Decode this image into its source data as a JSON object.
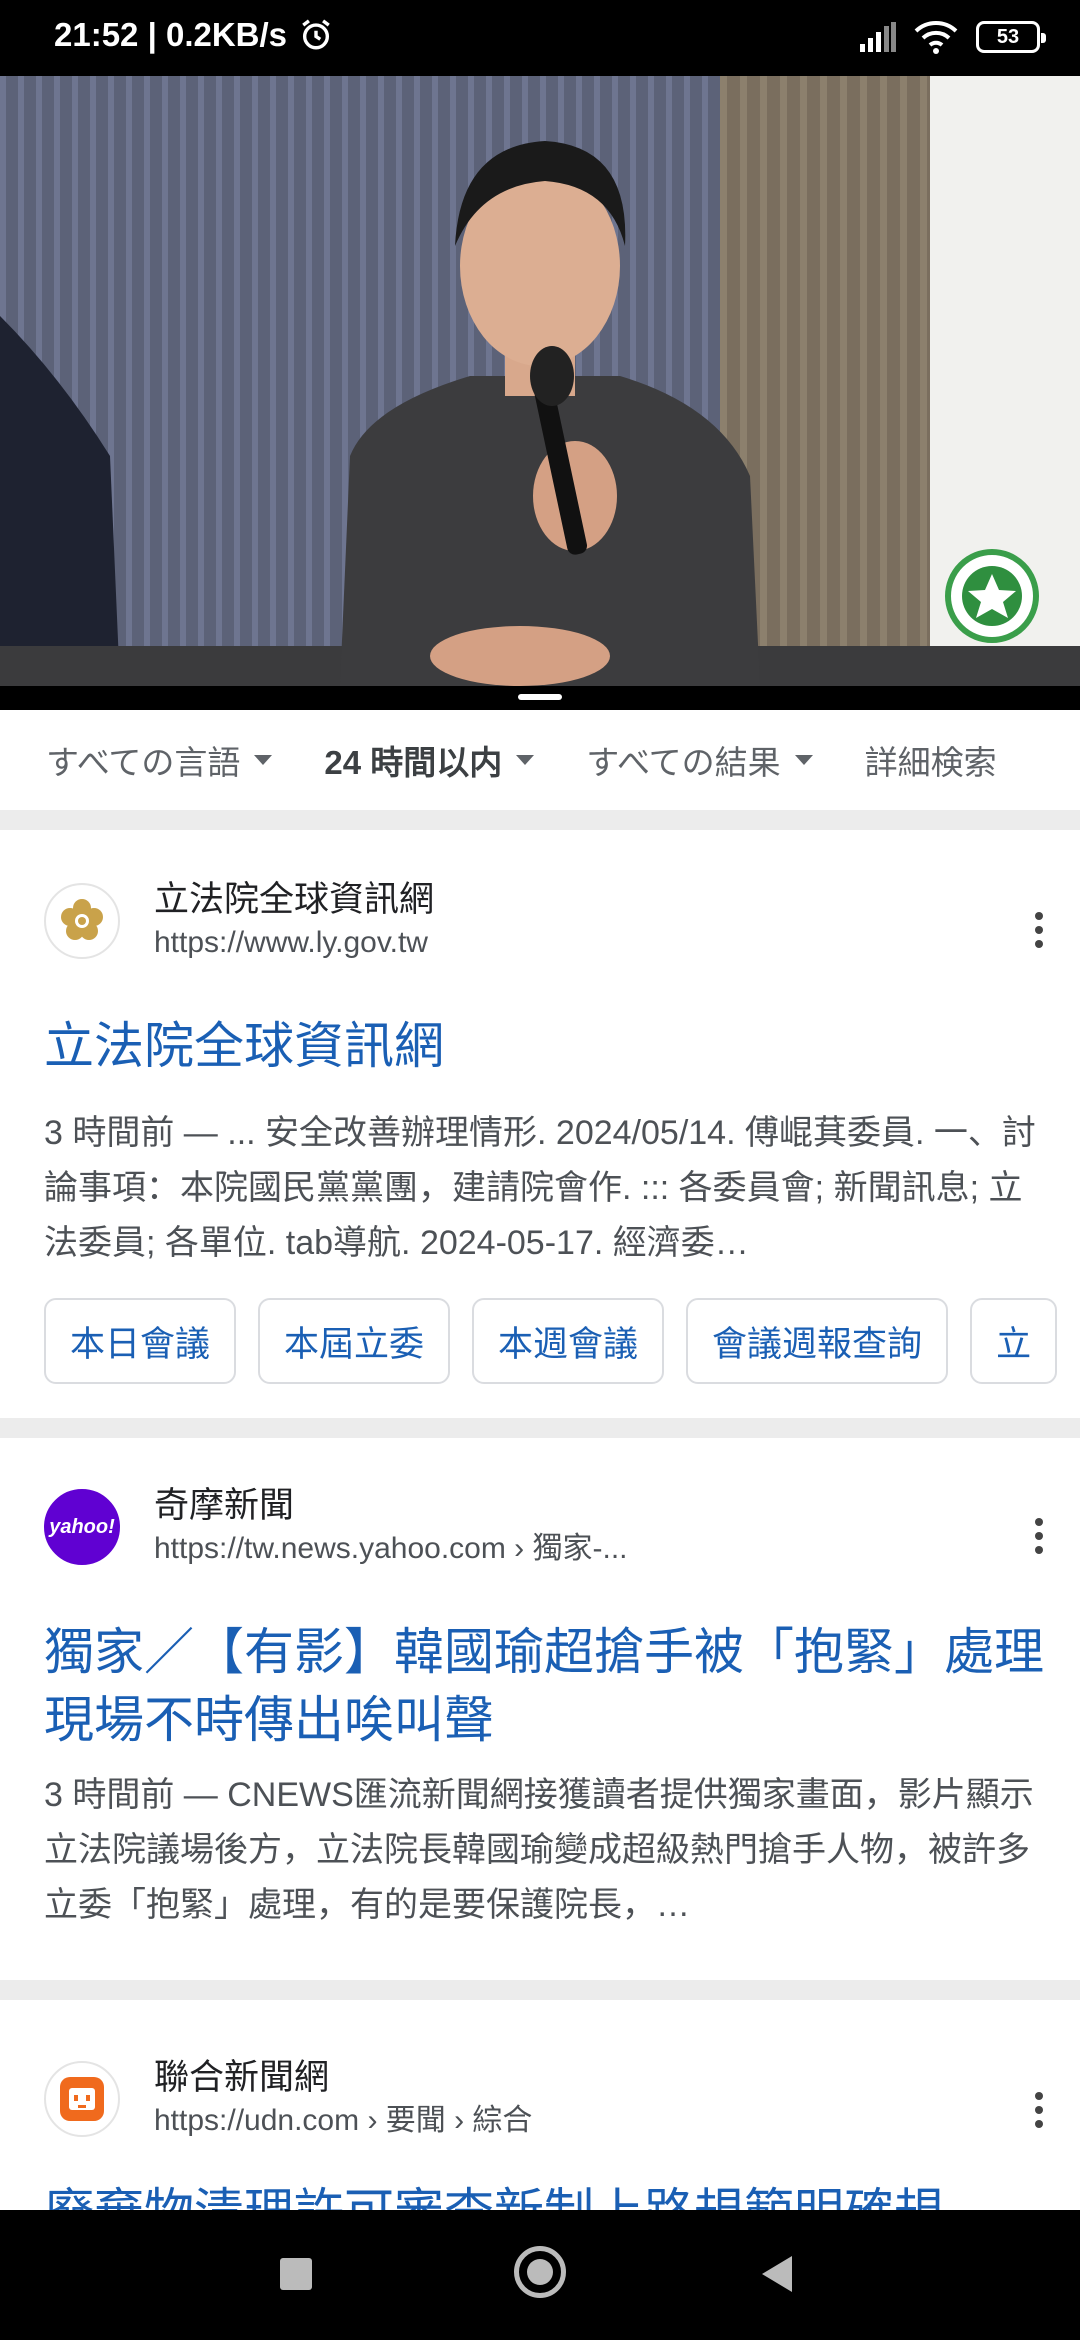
{
  "status_bar": {
    "time_speed": "21:52 | 0.2KB/s",
    "battery": "53",
    "icons": [
      "alarm-icon",
      "signal-icon",
      "wifi-icon",
      "battery-icon"
    ]
  },
  "video": {
    "description_icon": "emblem-logo"
  },
  "filters": [
    {
      "label": "すべての言語",
      "active": false
    },
    {
      "label": "24 時間以内",
      "active": true
    },
    {
      "label": "すべての結果",
      "active": false
    },
    {
      "label": "詳細検索",
      "active": false
    }
  ],
  "results": [
    {
      "site_name": "立法院全球資訊網",
      "url": "https://www.ly.gov.tw",
      "url_crumbs": "",
      "title": "立法院全球資訊網",
      "snippet": "3 時間前 — ... 安全改善辦理情形. 2024/05/14. 傅崐萁委員. 一、討論事項：本院國民黨黨團，建請院會作. ::: 各委員會; 新聞訊息; 立法委員; 各單位. tab導航. 2024-05-17. 經濟委…",
      "chips": [
        "本日會議",
        "本屆立委",
        "本週會議",
        "會議週報查詢",
        "立"
      ]
    },
    {
      "site_name": "奇摩新聞",
      "url": "https://tw.news.yahoo.com",
      "url_crumbs": " › 獨家-...",
      "favicon_text": "yahoo!",
      "title": "獨家／【有影】韓國瑜超搶手被「抱緊」處理現場不時傳出唉叫聲",
      "snippet": "3 時間前 — CNEWS匯流新聞網接獲讀者提供獨家畫面，影片顯示立法院議場後方，立法院長韓國瑜變成超級熱門搶手人物，被許多立委「抱緊」處理，有的是要保護院長，…"
    },
    {
      "site_name": "聯合新聞網",
      "url": "https://udn.com",
      "url_crumbs": " › 要聞 › 綜合",
      "title": "廢棄物清理許可審查新制上路規範明確規"
    }
  ]
}
